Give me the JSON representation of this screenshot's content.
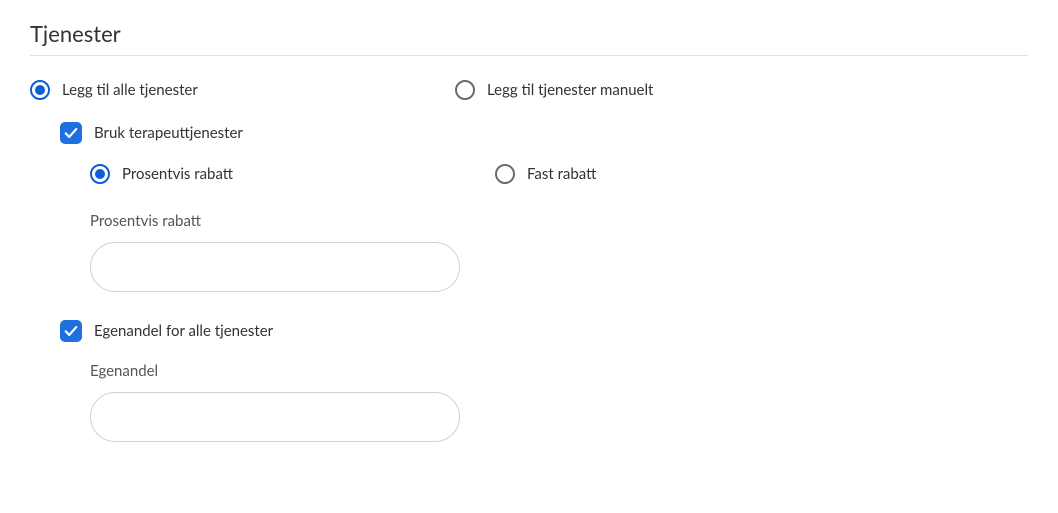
{
  "section": {
    "title": "Tjenester"
  },
  "serviceMode": {
    "addAll": {
      "label": "Legg til alle tjenester",
      "selected": true
    },
    "addManual": {
      "label": "Legg til tjenester manuelt",
      "selected": false
    }
  },
  "therapist": {
    "useLabel": "Bruk terapeuttjenester",
    "checked": true
  },
  "discountType": {
    "percent": {
      "label": "Prosentvis rabatt",
      "selected": true
    },
    "fixed": {
      "label": "Fast rabatt",
      "selected": false
    }
  },
  "discountField": {
    "label": "Prosentvis rabatt",
    "value": ""
  },
  "copay": {
    "allLabel": "Egenandel for alle tjenester",
    "checked": true
  },
  "copayField": {
    "label": "Egenandel",
    "value": ""
  }
}
